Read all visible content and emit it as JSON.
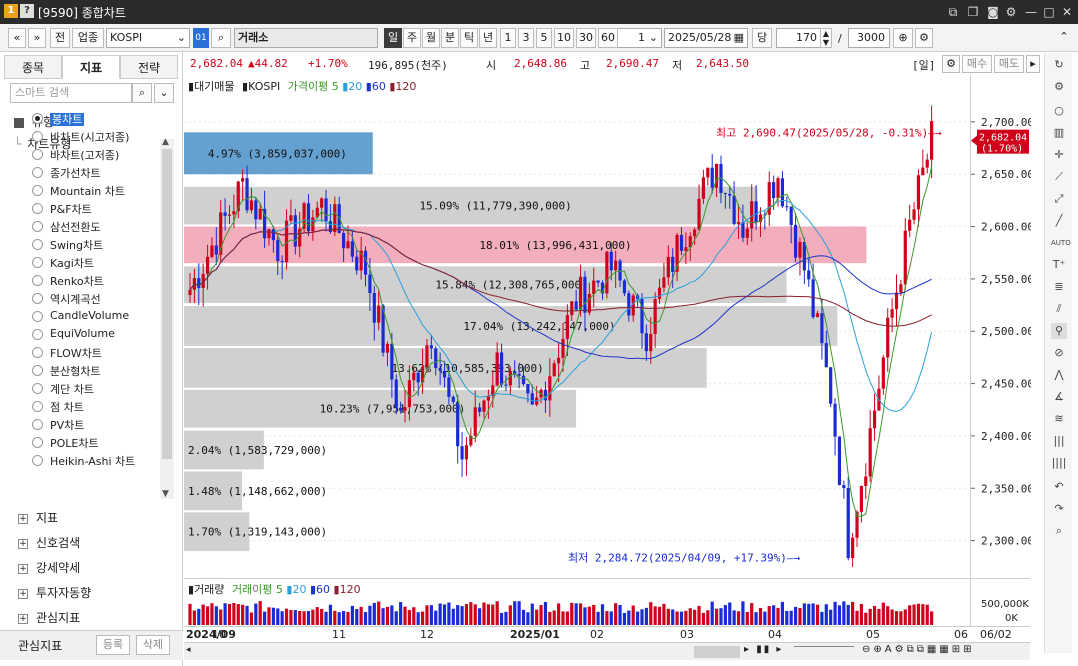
{
  "window": {
    "title": "[9590] 종합차트",
    "icon1": "1",
    "icon2": "?"
  },
  "toolbar": {
    "prev": "«",
    "next": "»",
    "btn_all": "전",
    "btn_sector": "업종",
    "symbol": "KOSPI",
    "code_icon": "01",
    "exchange": "거래소",
    "periods": [
      "일",
      "주",
      "월",
      "분",
      "틱",
      "년"
    ],
    "period_selected": "일",
    "intervals": [
      "1",
      "3",
      "5",
      "10",
      "30",
      "60"
    ],
    "count_value": "1",
    "date": "2025/05/28",
    "btn_dang": "당",
    "bars": "170",
    "slash": "/",
    "max_bars": "3000"
  },
  "quote": {
    "price": "2,682.04",
    "change": "▲44.82",
    "pct": "+1.70%",
    "volume": "196,895(천주)",
    "open_label": "시",
    "open": "2,648.86",
    "high_label": "고",
    "high": "2,690.47",
    "low_label": "저",
    "low": "2,643.50",
    "period_tag": "[일]",
    "btn_buy": "매수",
    "btn_sell": "매도"
  },
  "left": {
    "tabs": [
      "종목",
      "지표",
      "전략"
    ],
    "active_tab": "지표",
    "search_placeholder": "스마트 검색",
    "group_type": "유형",
    "subgroup": "차트유형",
    "chart_types": [
      "봉차트",
      "바차트(시고저종)",
      "바차트(고저종)",
      "종가선차트",
      "Mountain 차트",
      "P&F차트",
      "삼선전환도",
      "Swing차트",
      "Kagi차트",
      "Renko차트",
      "역시계곡선",
      "CandleVolume",
      "EquiVolume",
      "FLOW차트",
      "분산형차트",
      "계단 차트",
      "점 차트",
      "PV차트",
      "POLE차트",
      "Heikin-Ashi 차트"
    ],
    "selected_type": "봉차트",
    "groups": [
      "지표",
      "신호검색",
      "강세약세",
      "투자자동향",
      "관심지표"
    ],
    "footer_label": "관심지표",
    "footer_register": "등록",
    "footer_delete": "삭제"
  },
  "legend": {
    "main": "대기매물",
    "symbol": "KOSPI",
    "ma_label": "가격이평 5",
    "ma20": "20",
    "ma60": "60",
    "ma120": "120",
    "vol": "거래량",
    "vol_ma": "거래이평 5"
  },
  "colors": {
    "up": "#d0021b",
    "down": "#1a2bd6",
    "ma5": "#3c9a2b",
    "ma20": "#2aa0d8",
    "ma60": "#1f35c8",
    "ma120": "#8a1f2e",
    "vp_gray": "#c8c8c8",
    "vp_red": "#f0a0b0",
    "vp_blue": "#4a90c8"
  },
  "chart_data": {
    "type": "candlestick",
    "ylim": [
      2270,
      2740
    ],
    "yticks": [
      2300,
      2350,
      2400,
      2450,
      2500,
      2550,
      2600,
      2650,
      2700
    ],
    "ytick_labels": [
      "2,300.00",
      "2,350.00",
      "2,400.00",
      "2,450.00",
      "2,500.00",
      "2,550.00",
      "2,600.00",
      "2,650.00",
      "2,700.00"
    ],
    "current_price_label": "2,682.04",
    "current_pct_label": "(1.70%)",
    "high_annotation": "최고 2,690.47(2025/05/28, -0.31%)",
    "low_annotation": "최저 2,284.72(2025/04/09, +17.39%)",
    "volume_profile": [
      {
        "lo": 2650,
        "hi": 2690,
        "pct": "4.97%",
        "vol": "(3,859,037,000)",
        "w": 0.26,
        "kind": "blue"
      },
      {
        "lo": 2602,
        "hi": 2638,
        "pct": "15.09%",
        "vol": "(11,779,390,000)",
        "w": 0.79,
        "kind": "gray"
      },
      {
        "lo": 2565,
        "hi": 2600,
        "pct": "18.01%",
        "vol": "(13,996,431,000)",
        "w": 0.94,
        "kind": "red"
      },
      {
        "lo": 2527,
        "hi": 2562,
        "pct": "15.84%",
        "vol": "(12,308,765,000)",
        "w": 0.83,
        "kind": "gray"
      },
      {
        "lo": 2486,
        "hi": 2524,
        "pct": "17.04%",
        "vol": "(13,242,147,000)",
        "w": 0.9,
        "kind": "gray"
      },
      {
        "lo": 2446,
        "hi": 2484,
        "pct": "13.62%",
        "vol": "(10,585,393,000)",
        "w": 0.72,
        "kind": "gray"
      },
      {
        "lo": 2408,
        "hi": 2444,
        "pct": "10.23%",
        "vol": "(7,951,753,000)",
        "w": 0.54,
        "kind": "gray"
      },
      {
        "lo": 2368,
        "hi": 2405,
        "pct": "2.04%",
        "vol": "(1,583,729,000)",
        "w": 0.11,
        "kind": "gray"
      },
      {
        "lo": 2329,
        "hi": 2366,
        "pct": "1.48%",
        "vol": "(1,148,662,000)",
        "w": 0.08,
        "kind": "gray"
      },
      {
        "lo": 2290,
        "hi": 2327,
        "pct": "1.70%",
        "vol": "(1,319,143,000)",
        "w": 0.09,
        "kind": "gray"
      }
    ],
    "months": [
      "2024/09",
      "10",
      "11",
      "12",
      "2025/01",
      "02",
      "03",
      "04",
      "05",
      "06",
      "06/02"
    ],
    "volume_ticks": [
      "500,000K",
      "0K"
    ]
  }
}
